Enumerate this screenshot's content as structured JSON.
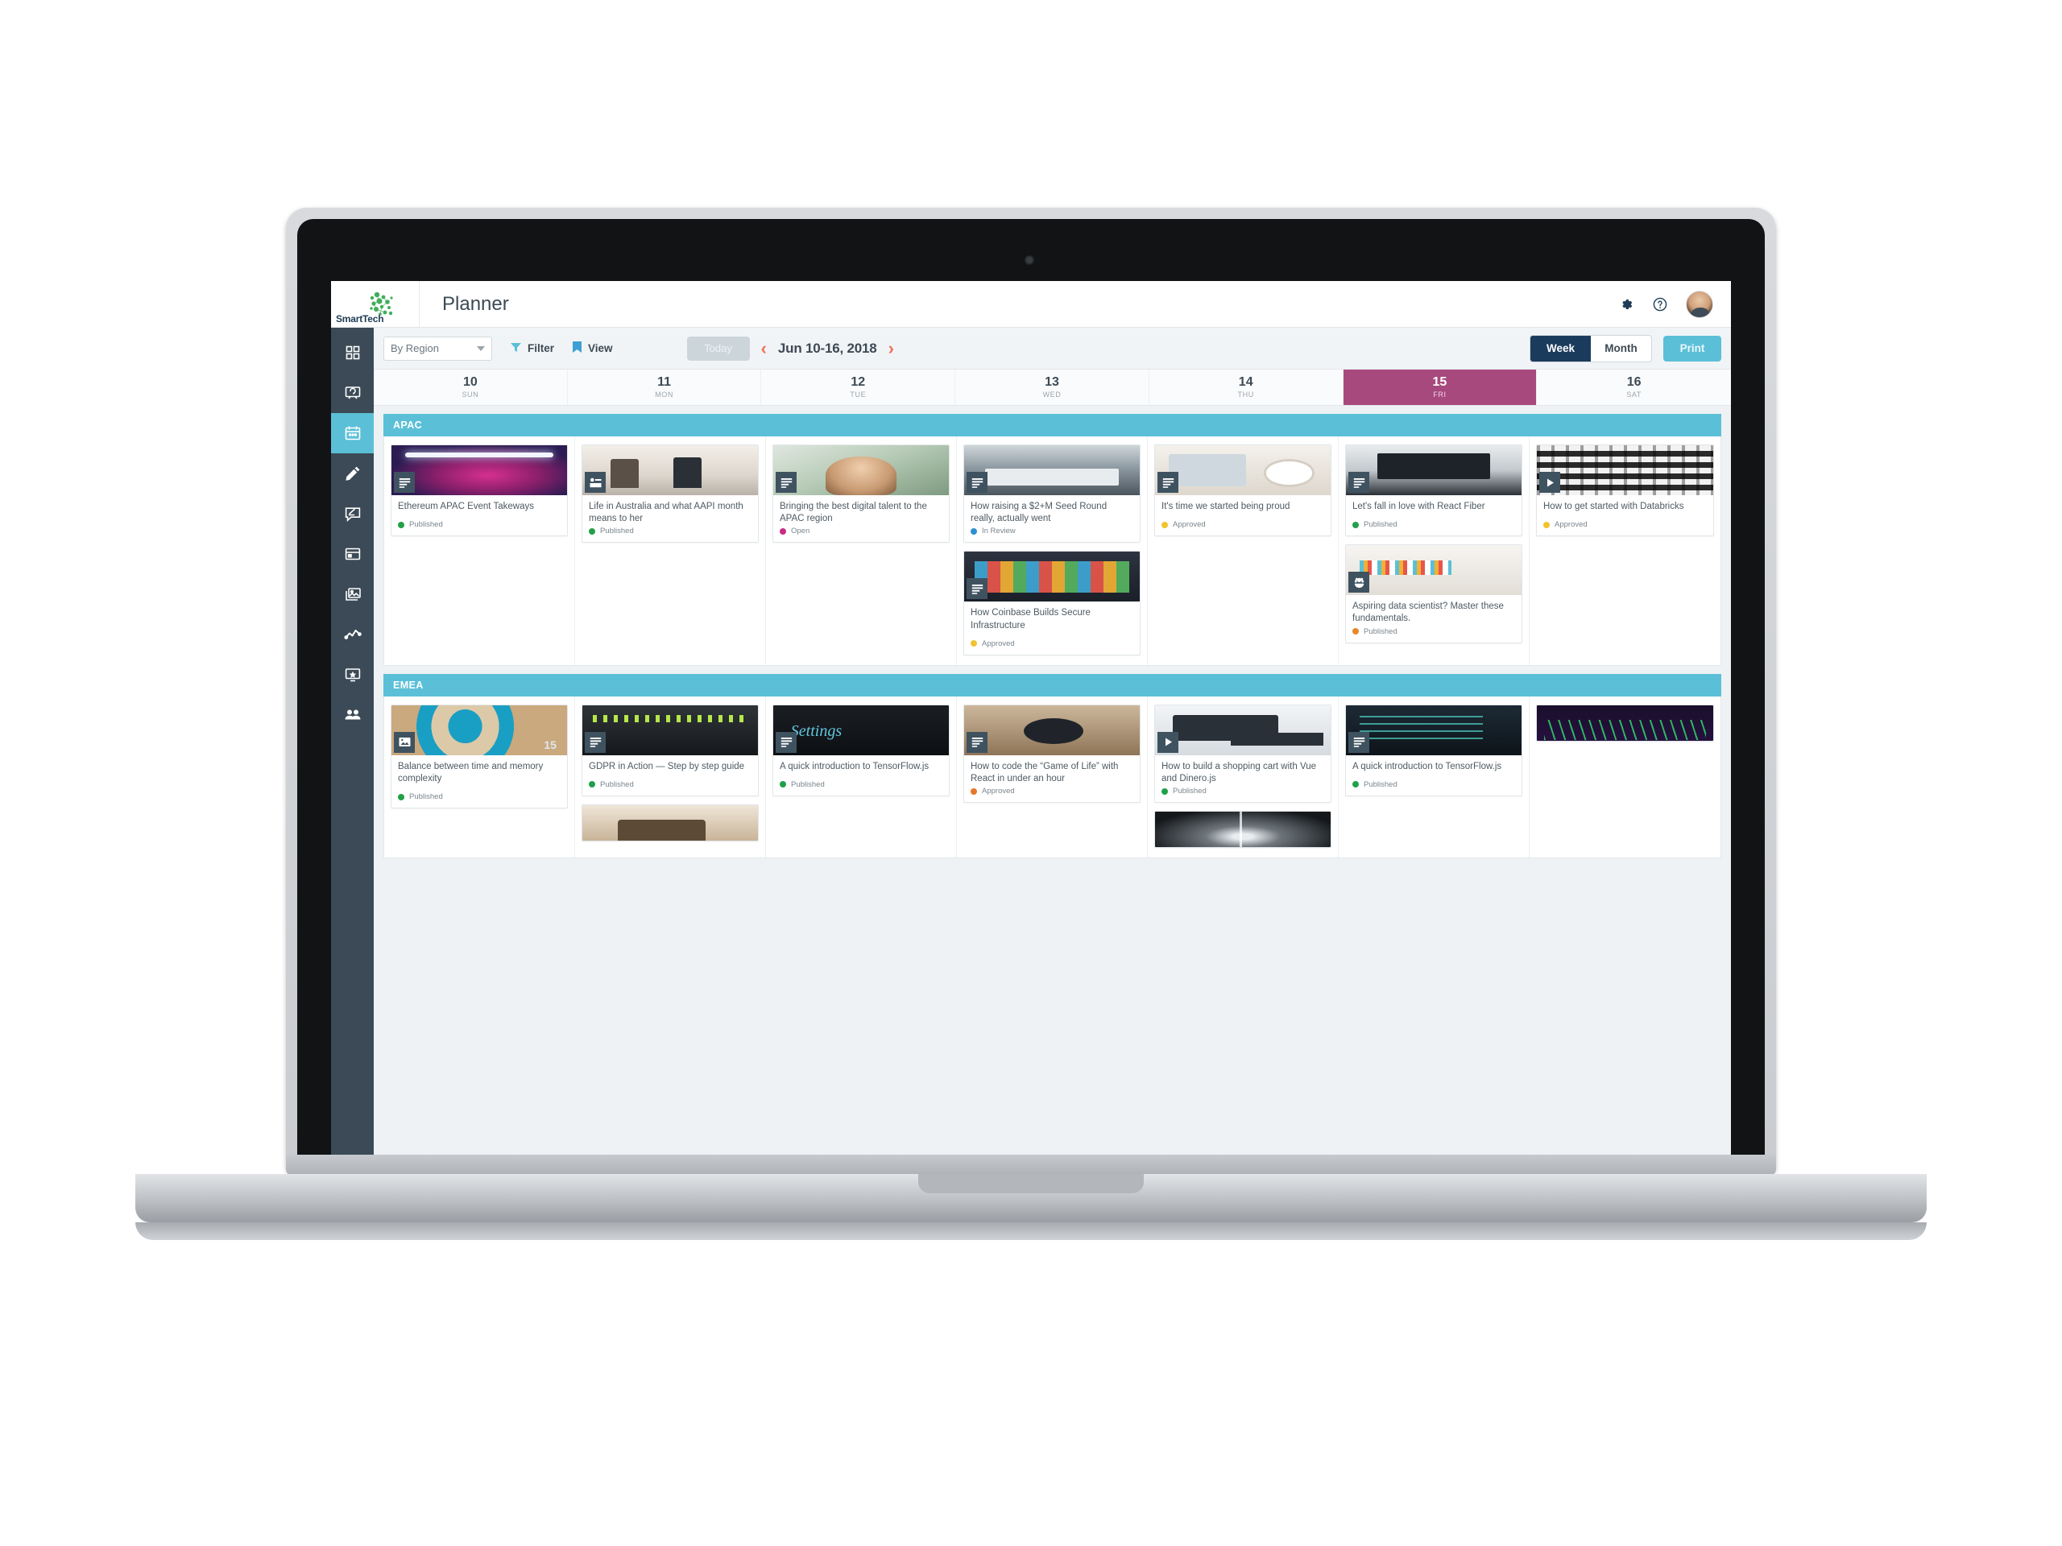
{
  "brand": {
    "name": "SmartTech",
    "logo_icon": "network-cluster-logo"
  },
  "header": {
    "title": "Planner",
    "actions": [
      {
        "name": "settings",
        "icon": "gear-icon"
      },
      {
        "name": "help",
        "icon": "question-circle-icon"
      },
      {
        "name": "profile",
        "icon": "avatar"
      }
    ]
  },
  "sidebar": {
    "items": [
      {
        "icon": "grid-dashboard-icon",
        "label": "Dashboard",
        "active": false
      },
      {
        "icon": "presentation-icon",
        "label": "Campaigns",
        "active": false
      },
      {
        "icon": "calendar-icon",
        "label": "Planner",
        "active": true
      },
      {
        "icon": "pencil-icon",
        "label": "Create",
        "active": false
      },
      {
        "icon": "comment-edit-icon",
        "label": "Ideas",
        "active": false
      },
      {
        "icon": "browser-window-icon",
        "label": "Pages",
        "active": false
      },
      {
        "icon": "images-icon",
        "label": "Assets",
        "active": false
      },
      {
        "icon": "analytics-trend-icon",
        "label": "Analytics",
        "active": false
      },
      {
        "icon": "star-screen-icon",
        "label": "Featured",
        "active": false
      },
      {
        "icon": "people-icon",
        "label": "Team",
        "active": false
      }
    ]
  },
  "toolbar": {
    "group_by": {
      "value": "By Region",
      "icon": "chevron-down-icon"
    },
    "filter": {
      "label": "Filter",
      "icon": "funnel-icon"
    },
    "view": {
      "label": "View",
      "icon": "bookmark-icon"
    },
    "today": "Today",
    "prev_icon": "chevron-left-icon",
    "next_icon": "chevron-right-icon",
    "date_range": "Jun 10-16, 2018",
    "week": "Week",
    "month": "Month",
    "print": "Print",
    "active_range": "Week"
  },
  "days": [
    {
      "num": "10",
      "name": "SUN",
      "today": false
    },
    {
      "num": "11",
      "name": "MON",
      "today": false
    },
    {
      "num": "12",
      "name": "TUE",
      "today": false
    },
    {
      "num": "13",
      "name": "WED",
      "today": false
    },
    {
      "num": "14",
      "name": "THU",
      "today": false
    },
    {
      "num": "15",
      "name": "FRI",
      "today": true
    },
    {
      "num": "16",
      "name": "SAT",
      "today": false
    }
  ],
  "status_colors": {
    "Published_green": "#21a04a",
    "Published_orange": "#e8862a",
    "Open": "#cc2a85",
    "In Review": "#2c8fd1",
    "Approved_yellow": "#f0c330",
    "Approved_orange": "#e8762a"
  },
  "accent": {
    "teal": "#5bc0d7",
    "navy": "#1b3b5c",
    "magenta": "#a8497e",
    "coral": "#f0705a"
  },
  "groups": [
    {
      "name": "APAC",
      "columns": [
        [
          {
            "title": "Ethereum APAC Event Takeways",
            "status": "Published",
            "dot": "#21a04a",
            "type_icon": "article-icon",
            "thumb": "t-stage"
          }
        ],
        [
          {
            "title": "Life in Australia and what AAPI month means to her",
            "status": "Published",
            "dot": "#21a04a",
            "type_icon": "blog-post-icon",
            "thumb": "t-panel"
          }
        ],
        [
          {
            "title": "Bringing the best digital talent to the APAC region",
            "status": "Open",
            "dot": "#cc2a85",
            "type_icon": "article-icon",
            "thumb": "t-portrait"
          }
        ],
        [
          {
            "title": "How raising a $2+M Seed Round really, actually went",
            "status": "In Review",
            "dot": "#2c8fd1",
            "type_icon": "article-icon",
            "thumb": "t-desk"
          },
          {
            "title": "How Coinbase Builds Secure Infrastructure",
            "status": "Approved",
            "dot": "#f0c330",
            "type_icon": "article-icon",
            "thumb": "t-cards"
          }
        ],
        [
          {
            "title": "It's time we started being proud",
            "status": "Approved",
            "dot": "#f0c330",
            "type_icon": "article-icon",
            "thumb": "t-coffee"
          }
        ],
        [
          {
            "title": "Let's fall in love with React Fiber",
            "status": "Published",
            "dot": "#21a04a",
            "type_icon": "article-icon",
            "thumb": "t-laptop"
          },
          {
            "title": "Aspiring data scientist? Master these fundamentals.",
            "status": "Published",
            "dot": "#e8862a",
            "type_icon": "flower-icon",
            "thumb": "t-charts"
          }
        ],
        [
          {
            "title": "How to get started with Databricks",
            "status": "Approved",
            "dot": "#f0c330",
            "type_icon": "video-play-icon",
            "thumb": "t-rack"
          }
        ]
      ]
    },
    {
      "name": "EMEA",
      "columns": [
        [
          {
            "title": "Balance between time and memory complexity",
            "status": "Published",
            "dot": "#21a04a",
            "type_icon": "image-icon",
            "thumb": "t-darts"
          }
        ],
        [
          {
            "title": "GDPR in Action — Step by step guide",
            "status": "Published",
            "dot": "#21a04a",
            "type_icon": "article-icon",
            "thumb": "t-server"
          },
          {
            "title": "",
            "status": "",
            "dot": "",
            "type_icon": "",
            "thumb": "t-meeting",
            "cut": true
          }
        ],
        [
          {
            "title": "A quick introduction to TensorFlow.js",
            "status": "Published",
            "dot": "#21a04a",
            "type_icon": "article-icon",
            "thumb": "t-settings"
          }
        ],
        [
          {
            "title": "How to code the “Game of Life” with React in under an hour",
            "status": "Approved",
            "dot": "#e8762a",
            "type_icon": "article-icon",
            "thumb": "t-hand"
          }
        ],
        [
          {
            "title": "How to build a shopping cart with Vue and Dinero.js",
            "status": "Published",
            "dot": "#21a04a",
            "type_icon": "video-play-icon",
            "thumb": "t-devices"
          },
          {
            "title": "",
            "status": "",
            "dot": "",
            "type_icon": "",
            "thumb": "t-corridor",
            "cut": true
          }
        ],
        [
          {
            "title": "A quick introduction to TensorFlow.js",
            "status": "Published",
            "dot": "#21a04a",
            "type_icon": "article-icon",
            "thumb": "t-code"
          }
        ],
        [
          {
            "title": "",
            "status": "",
            "dot": "",
            "type_icon": "",
            "thumb": "t-trading",
            "cut": true
          }
        ]
      ]
    }
  ]
}
